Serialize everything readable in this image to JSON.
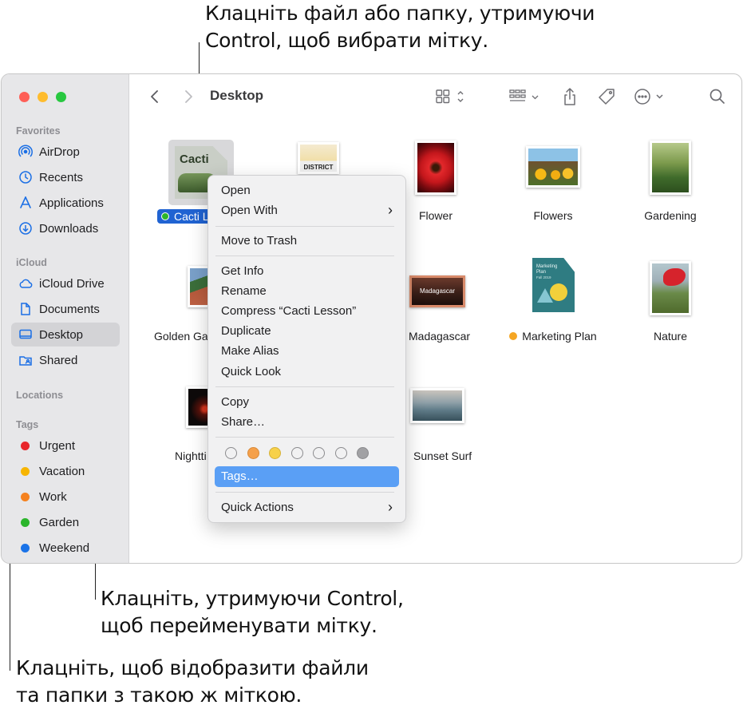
{
  "callouts": {
    "top": [
      "Клацніть файл або папку, утримуючи",
      "Control, щоб вибрати мітку."
    ],
    "middle": [
      "Клацніть, утримуючи Control,",
      "щоб перейменувати мітку."
    ],
    "bottom": [
      "Клацніть, щоб відобразити файли",
      "та папки з такою ж міткою."
    ]
  },
  "window": {
    "title": "Desktop"
  },
  "sidebar": {
    "favorites_header": "Favorites",
    "favorites": [
      {
        "label": "AirDrop",
        "icon": "airdrop-icon"
      },
      {
        "label": "Recents",
        "icon": "clock-icon"
      },
      {
        "label": "Applications",
        "icon": "applications-icon"
      },
      {
        "label": "Downloads",
        "icon": "download-icon"
      }
    ],
    "icloud_header": "iCloud",
    "icloud": [
      {
        "label": "iCloud Drive",
        "icon": "cloud-icon"
      },
      {
        "label": "Documents",
        "icon": "document-icon"
      },
      {
        "label": "Desktop",
        "icon": "desktop-icon",
        "selected": true
      },
      {
        "label": "Shared",
        "icon": "shared-folder-icon"
      }
    ],
    "locations_header": "Locations",
    "tags_header": "Tags",
    "tags": [
      {
        "label": "Urgent",
        "color": "#e8262b"
      },
      {
        "label": "Vacation",
        "color": "#f7b500"
      },
      {
        "label": "Work",
        "color": "#f5821f"
      },
      {
        "label": "Garden",
        "color": "#2bb52b"
      },
      {
        "label": "Weekend",
        "color": "#1a73e8"
      }
    ]
  },
  "files": [
    {
      "name": "Cacti Lesson",
      "display": "Cacti Le",
      "tag": "#2bb52b",
      "selected": true
    },
    {
      "name": "District"
    },
    {
      "name": "Flower"
    },
    {
      "name": "Flowers"
    },
    {
      "name": "Gardening"
    },
    {
      "name": "Golden Ga"
    },
    {
      "name": "Madagascar"
    },
    {
      "name": "Marketing Plan",
      "tag": "#f5a623"
    },
    {
      "name": "Nature"
    },
    {
      "name": "Nightti"
    },
    {
      "name": "Sunset Surf"
    }
  ],
  "thumb_text": {
    "cacti": "Cacti",
    "district": "DISTRICT",
    "madagascar": "Madagascar",
    "marketing_title": "Marketing Plan",
    "marketing_sub": "Fall 2019"
  },
  "context_menu": {
    "open": "Open",
    "open_with": "Open With",
    "move_to_trash": "Move to Trash",
    "get_info": "Get Info",
    "rename": "Rename",
    "compress": "Compress “Cacti Lesson”",
    "duplicate": "Duplicate",
    "make_alias": "Make Alias",
    "quick_look": "Quick Look",
    "copy": "Copy",
    "share": "Share…",
    "tags": "Tags…",
    "quick_actions": "Quick Actions",
    "submenu_arrow": "›",
    "tag_colors": [
      "none",
      "#f5a04a",
      "#f7d14a",
      "none",
      "none",
      "none",
      "#a1a1a4"
    ]
  }
}
